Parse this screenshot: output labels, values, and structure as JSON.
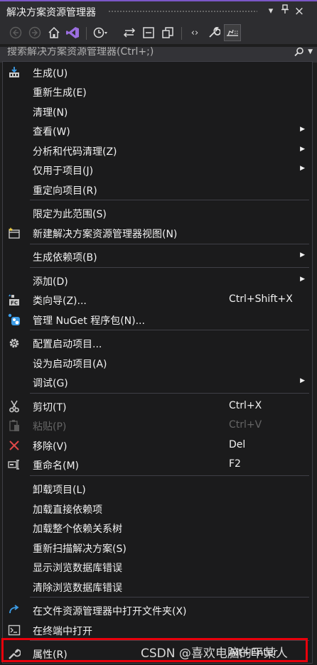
{
  "panel": {
    "title": "解决方案资源管理器",
    "dropdown_icon": "▾",
    "pin_icon": "pin",
    "close_icon": "×"
  },
  "search": {
    "placeholder": "搜索解决方案资源管理器(Ctrl+;)"
  },
  "toolbar": {
    "buttons": [
      "back-icon",
      "forward-icon",
      "home-icon",
      "vs-icon",
      "history-icon",
      "sync-icon",
      "collapse-icon",
      "copy-view-icon",
      "code-icon",
      "properties-wrench-icon",
      "preview-icon"
    ]
  },
  "menu": {
    "items": [
      {
        "label": "生成(U)",
        "icon": "build-icon"
      },
      {
        "label": "重新生成(E)"
      },
      {
        "label": "清理(N)"
      },
      {
        "label": "查看(W)",
        "submenu": true
      },
      {
        "label": "分析和代码清理(Z)",
        "submenu": true
      },
      {
        "label": "仅用于项目(J)",
        "submenu": true
      },
      {
        "label": "重定向项目(R)"
      },
      {
        "label": "限定为此范围(S)"
      },
      {
        "label": "新建解决方案资源管理器视图(N)",
        "icon": "new-view-icon"
      },
      {
        "label": "生成依赖项(B)",
        "submenu": true
      },
      {
        "label": "添加(D)",
        "submenu": true
      },
      {
        "label": "类向导(Z)...",
        "shortcut": "Ctrl+Shift+X",
        "icon": "class-wizard-icon"
      },
      {
        "label": "管理 NuGet 程序包(N)...",
        "icon": "nuget-icon"
      },
      {
        "label": "配置启动项目...",
        "icon": "gear-icon"
      },
      {
        "label": "设为启动项目(A)"
      },
      {
        "label": "调试(G)",
        "submenu": true
      },
      {
        "label": "剪切(T)",
        "shortcut": "Ctrl+X",
        "icon": "scissors-icon"
      },
      {
        "label": "粘贴(P)",
        "shortcut": "Ctrl+V",
        "icon": "paste-icon",
        "disabled": true
      },
      {
        "label": "移除(V)",
        "shortcut": "Del",
        "icon": "remove-icon"
      },
      {
        "label": "重命名(M)",
        "shortcut": "F2",
        "icon": "rename-icon"
      },
      {
        "label": "卸载项目(L)"
      },
      {
        "label": "加载直接依赖项"
      },
      {
        "label": "加载整个依赖关系树"
      },
      {
        "label": "重新扫描解决方案(S)"
      },
      {
        "label": "显示浏览数据库错误"
      },
      {
        "label": "清除浏览数据库错误"
      },
      {
        "label": "在文件资源管理器中打开文件夹(X)",
        "icon": "open-folder-icon"
      },
      {
        "label": "在终端中打开",
        "icon": "terminal-icon"
      },
      {
        "label": "属性(R)",
        "shortcut": "Alt+Enter",
        "icon": "wrench-icon"
      }
    ]
  },
  "watermark": "CSDN @喜欢电脑的平某人",
  "colors": {
    "background": "#1e1e1e",
    "menu_background": "#1b1b1c",
    "text": "#f1f1f1",
    "disabled_text": "#656565",
    "highlight_border": "#e8000b",
    "accent": "#7b57c7"
  }
}
